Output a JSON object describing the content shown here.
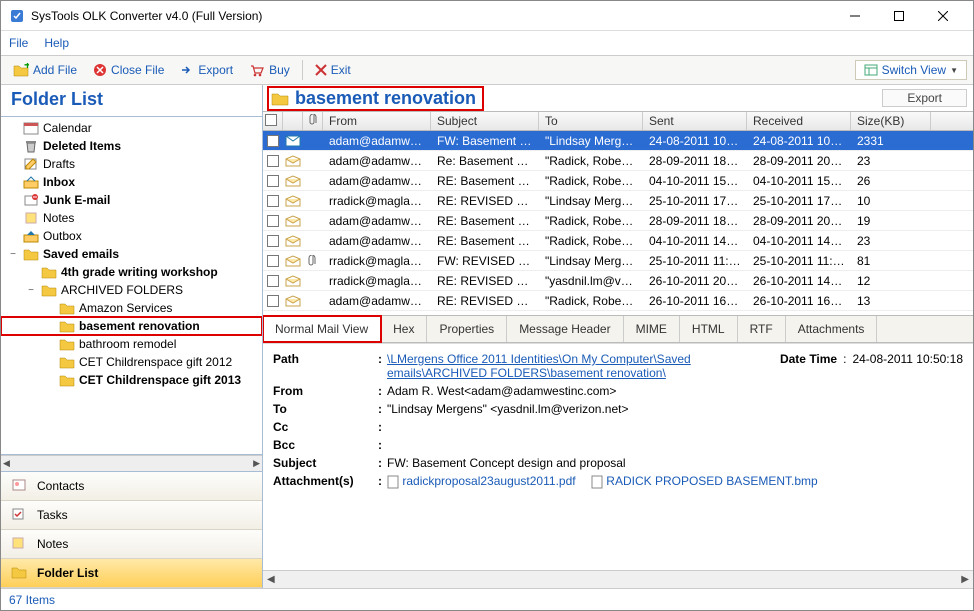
{
  "window": {
    "title": "SysTools OLK Converter v4.0 (Full Version)"
  },
  "menu": {
    "file": "File",
    "help": "Help"
  },
  "toolbar": {
    "add_file": "Add File",
    "close_file": "Close File",
    "export": "Export",
    "buy": "Buy",
    "exit": "Exit",
    "switch_view": "Switch View"
  },
  "left": {
    "title": "Folder List",
    "nodes": [
      {
        "indent": 0,
        "exp": "",
        "icon": "calendar",
        "label": "Calendar",
        "bold": false
      },
      {
        "indent": 0,
        "exp": "",
        "icon": "trash",
        "label": "Deleted Items",
        "bold": true
      },
      {
        "indent": 0,
        "exp": "",
        "icon": "drafts",
        "label": "Drafts",
        "bold": false
      },
      {
        "indent": 0,
        "exp": "",
        "icon": "inbox",
        "label": "Inbox",
        "bold": true
      },
      {
        "indent": 0,
        "exp": "",
        "icon": "junk",
        "label": "Junk E-mail",
        "bold": true
      },
      {
        "indent": 0,
        "exp": "",
        "icon": "notes",
        "label": "Notes",
        "bold": false
      },
      {
        "indent": 0,
        "exp": "",
        "icon": "outbox",
        "label": "Outbox",
        "bold": false
      },
      {
        "indent": 0,
        "exp": "−",
        "icon": "folder",
        "label": "Saved emails",
        "bold": true
      },
      {
        "indent": 1,
        "exp": "",
        "icon": "folder",
        "label": "4th grade writing workshop",
        "bold": true
      },
      {
        "indent": 1,
        "exp": "−",
        "icon": "folder",
        "label": "ARCHIVED FOLDERS",
        "bold": false
      },
      {
        "indent": 2,
        "exp": "",
        "icon": "folder",
        "label": "Amazon Services",
        "bold": false
      },
      {
        "indent": 2,
        "exp": "",
        "icon": "folder",
        "label": "basement renovation",
        "bold": true,
        "highlight": true
      },
      {
        "indent": 2,
        "exp": "",
        "icon": "folder",
        "label": "bathroom remodel",
        "bold": false
      },
      {
        "indent": 2,
        "exp": "",
        "icon": "folder",
        "label": "CET Childrenspace gift 2012",
        "bold": false
      },
      {
        "indent": 2,
        "exp": "",
        "icon": "folder",
        "label": "CET Childrenspace gift 2013",
        "bold": true
      }
    ],
    "nav": [
      {
        "icon": "contacts",
        "label": "Contacts"
      },
      {
        "icon": "tasks",
        "label": "Tasks"
      },
      {
        "icon": "notes",
        "label": "Notes"
      },
      {
        "icon": "folder",
        "label": "Folder List",
        "active": true
      }
    ]
  },
  "right": {
    "crumb": "basement renovation",
    "export": "Export",
    "columns": {
      "from": "From",
      "subject": "Subject",
      "to": "To",
      "sent": "Sent",
      "received": "Received",
      "size": "Size(KB)"
    },
    "rows": [
      {
        "sel": true,
        "att": false,
        "from": "adam@adamwes...",
        "subject": "FW: Basement C...",
        "to": "\"Lindsay Mergen...",
        "sent": "24-08-2011 10:50...",
        "recv": "24-08-2011 10:57...",
        "size": "2331"
      },
      {
        "sel": false,
        "att": false,
        "from": "adam@adamwes...",
        "subject": "Re: Basement Co...",
        "to": "\"Radick, Robert ...",
        "sent": "28-09-2011 18:30...",
        "recv": "28-09-2011 20:07...",
        "size": "23"
      },
      {
        "sel": false,
        "att": false,
        "from": "adam@adamwes...",
        "subject": "RE: Basement Co...",
        "to": "\"Radick, Robert ...",
        "sent": "04-10-2011 15:43...",
        "recv": "04-10-2011 15:46...",
        "size": "26"
      },
      {
        "sel": false,
        "att": false,
        "from": "rradick@maglaw...",
        "subject": "RE: REVISED PR...",
        "to": "\"Lindsay Mergen...",
        "sent": "25-10-2011 17:39...",
        "recv": "25-10-2011 17:44...",
        "size": "10"
      },
      {
        "sel": false,
        "att": false,
        "from": "adam@adamwes...",
        "subject": "RE: Basement Co...",
        "to": "\"Radick, Robert ...",
        "sent": "28-09-2011 18:01...",
        "recv": "28-09-2011 20:07...",
        "size": "19"
      },
      {
        "sel": false,
        "att": false,
        "from": "adam@adamwes...",
        "subject": "RE: Basement Co...",
        "to": "\"Radick, Robert ...",
        "sent": "04-10-2011 14:10...",
        "recv": "04-10-2011 14:13...",
        "size": "23"
      },
      {
        "sel": false,
        "att": true,
        "from": "rradick@maglaw...",
        "subject": "FW: REVISED PR...",
        "to": "\"Lindsay Mergen...",
        "sent": "25-10-2011 11:06...",
        "recv": "25-10-2011 11:08...",
        "size": "81"
      },
      {
        "sel": false,
        "att": false,
        "from": "rradick@maglaw...",
        "subject": "RE: REVISED PR...",
        "to": "\"yasdnil.lm@veri...",
        "sent": "26-10-2011 20:41...",
        "recv": "26-10-2011 14:50...",
        "size": "12"
      },
      {
        "sel": false,
        "att": false,
        "from": "adam@adamwes...",
        "subject": "RE: REVISED PR...",
        "to": "\"Radick, Robert ...",
        "sent": "26-10-2011 16:04...",
        "recv": "26-10-2011 16:10...",
        "size": "13"
      }
    ],
    "tabs": [
      "Normal Mail View",
      "Hex",
      "Properties",
      "Message Header",
      "MIME",
      "HTML",
      "RTF",
      "Attachments"
    ],
    "active_tab": 0,
    "detail": {
      "path_label": "Path",
      "path_val": "\\LMergens  Office 2011 Identities\\On My Computer\\Saved emails\\ARCHIVED FOLDERS\\basement renovation\\",
      "datetime_label": "Date Time",
      "datetime_sep": ":",
      "datetime_val": "24-08-2011 10:50:18",
      "from_label": "From",
      "from_val": "Adam R. West<adam@adamwestinc.com>",
      "to_label": "To",
      "to_val": "\"Lindsay Mergens\" <yasdnil.lm@verizon.net>",
      "cc_label": "Cc",
      "cc_val": "",
      "bcc_label": "Bcc",
      "bcc_val": "",
      "subject_label": "Subject",
      "subject_val": "FW: Basement Concept design and proposal",
      "att_label": "Attachment(s)",
      "att1": "radickproposal23august2011.pdf",
      "att2": "RADICK PROPOSED BASEMENT.bmp"
    }
  },
  "status": {
    "items": "67 Items"
  }
}
